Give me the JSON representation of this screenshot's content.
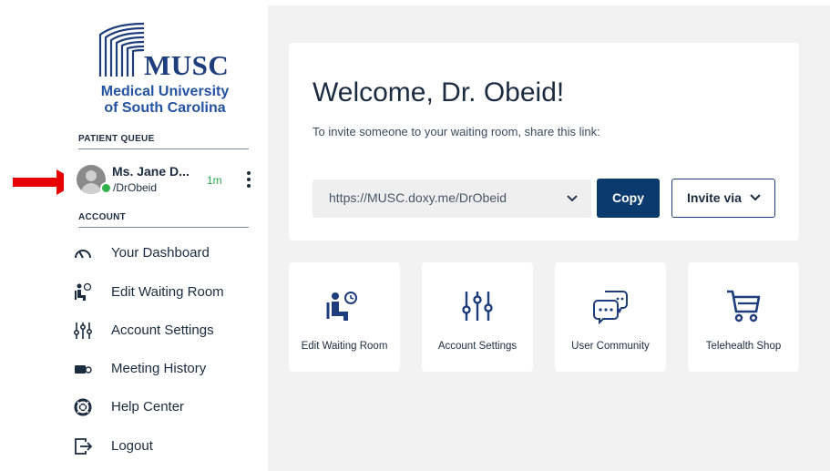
{
  "colors": {
    "brand_navy": "#1e3d7c",
    "brand_blue": "#2453a4",
    "copy_button": "#0b3a6e",
    "online_green": "#31b24a",
    "pointer_arrow": "#e60000",
    "main_background": "#f2f2f2"
  },
  "logo": {
    "wordmark": "MUSC",
    "subtitle_line1": "Medical University",
    "subtitle_line2": "of South Carolina"
  },
  "sidebar": {
    "patient_queue_title": "PATIENT QUEUE",
    "queue": [
      {
        "name": "Ms. Jane D...",
        "room": "/DrObeid",
        "wait_time": "1m",
        "status": "online"
      }
    ],
    "account_title": "ACCOUNT",
    "nav": [
      {
        "label": "Your Dashboard",
        "icon": "speedometer-icon"
      },
      {
        "label": "Edit Waiting Room",
        "icon": "waiting-room-icon"
      },
      {
        "label": "Account Settings",
        "icon": "sliders-icon"
      },
      {
        "label": "Meeting History",
        "icon": "video-camera-icon"
      },
      {
        "label": "Help Center",
        "icon": "lifebuoy-icon"
      },
      {
        "label": "Logout",
        "icon": "logout-icon"
      }
    ]
  },
  "main": {
    "welcome_title": "Welcome, Dr. Obeid!",
    "invite_text": "To invite someone to your waiting room, share this link:",
    "room_link": "https://MUSC.doxy.me/DrObeid",
    "copy_label": "Copy",
    "invite_via_label": "Invite via",
    "tiles": [
      {
        "label": "Edit Waiting Room",
        "icon": "waiting-room-icon"
      },
      {
        "label": "Account Settings",
        "icon": "sliders-icon"
      },
      {
        "label": "User Community",
        "icon": "chat-bubbles-icon"
      },
      {
        "label": "Telehealth Shop",
        "icon": "shopping-cart-icon"
      }
    ]
  }
}
